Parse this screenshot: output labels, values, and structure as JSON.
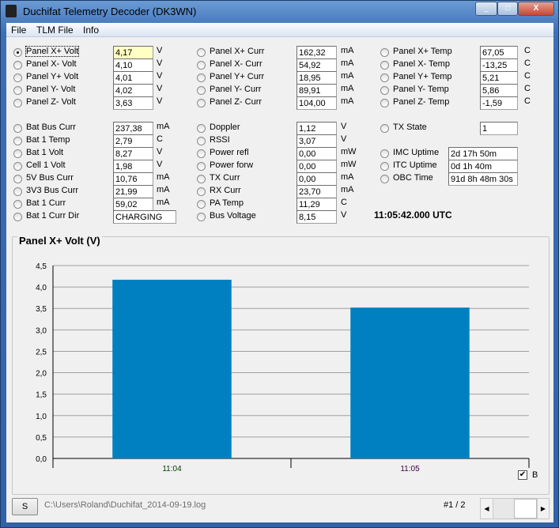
{
  "window": {
    "title": "Duchifat Telemetry Decoder (DK3WN)",
    "minimize": "_",
    "maximize": "□",
    "close": "X"
  },
  "menu": [
    "File",
    "TLM File",
    "Info"
  ],
  "col1": [
    {
      "label": "Panel X+ Volt",
      "value": "4,17",
      "unit": "V",
      "selected": true
    },
    {
      "label": "Panel X- Volt",
      "value": "4,10",
      "unit": "V"
    },
    {
      "label": "Panel Y+ Volt",
      "value": "4,01",
      "unit": "V"
    },
    {
      "label": "Panel Y- Volt",
      "value": "4,02",
      "unit": "V"
    },
    {
      "label": "Panel Z- Volt",
      "value": "3,63",
      "unit": "V"
    },
    {
      "label": "Bat Bus Curr",
      "value": "237,38",
      "unit": "mA"
    },
    {
      "label": "Bat 1 Temp",
      "value": "2,79",
      "unit": "C"
    },
    {
      "label": "Bat 1 Volt",
      "value": "8,27",
      "unit": "V"
    },
    {
      "label": "Cell 1 Volt",
      "value": "1,98",
      "unit": "V"
    },
    {
      "label": "5V Bus Curr",
      "value": "10,76",
      "unit": "mA"
    },
    {
      "label": "3V3 Bus Curr",
      "value": "21,99",
      "unit": "mA"
    },
    {
      "label": "Bat 1 Curr",
      "value": "59,02",
      "unit": "mA"
    },
    {
      "label": "Bat 1 Curr Dir",
      "value": "CHARGING",
      "unit": ""
    }
  ],
  "col2": [
    {
      "label": "Panel X+ Curr",
      "value": "162,32",
      "unit": "mA"
    },
    {
      "label": "Panel X- Curr",
      "value": "54,92",
      "unit": "mA"
    },
    {
      "label": "Panel Y+ Curr",
      "value": "18,95",
      "unit": "mA"
    },
    {
      "label": "Panel Y- Curr",
      "value": "89,91",
      "unit": "mA"
    },
    {
      "label": "Panel Z- Curr",
      "value": "104,00",
      "unit": "mA"
    },
    {
      "label": "Doppler",
      "value": "1,12",
      "unit": "V"
    },
    {
      "label": "RSSI",
      "value": "3,07",
      "unit": "V"
    },
    {
      "label": "Power refl",
      "value": "0,00",
      "unit": "mW"
    },
    {
      "label": "Power forw",
      "value": "0,00",
      "unit": "mW"
    },
    {
      "label": "TX Curr",
      "value": "0,00",
      "unit": "mA"
    },
    {
      "label": "RX Curr",
      "value": "23,70",
      "unit": "mA"
    },
    {
      "label": "PA Temp",
      "value": "11,29",
      "unit": "C"
    },
    {
      "label": "Bus Voltage",
      "value": "8,15",
      "unit": "V"
    }
  ],
  "col3": [
    {
      "label": "Panel X+ Temp",
      "value": "67,05",
      "unit": "C"
    },
    {
      "label": "Panel X- Temp",
      "value": "-13,25",
      "unit": "C"
    },
    {
      "label": "Panel Y+ Temp",
      "value": "5,21",
      "unit": "C"
    },
    {
      "label": "Panel Y- Temp",
      "value": "5,86",
      "unit": "C"
    },
    {
      "label": "Panel Z- Temp",
      "value": "-1,59",
      "unit": "C"
    },
    {
      "label": "TX State",
      "value": "1",
      "unit": ""
    }
  ],
  "uptimes": [
    {
      "label": "IMC Uptime",
      "value": "2d 17h 50m"
    },
    {
      "label": "ITC Uptime",
      "value": "0d 1h 40m"
    },
    {
      "label": "OBC Time",
      "value": "91d 8h 48m 30s"
    }
  ],
  "utc": "11:05:42.000 UTC",
  "chart_data": {
    "type": "bar",
    "title": "Panel X+ Volt (V)",
    "categories": [
      "11:04",
      "11:05"
    ],
    "values": [
      4.17,
      3.52
    ],
    "ylim": [
      0,
      4.5
    ],
    "yticks": [
      "0,0",
      "0,5",
      "1,0",
      "1,5",
      "2,0",
      "2,5",
      "3,0",
      "3,5",
      "4,0",
      "4,5"
    ],
    "grid": true,
    "bar_color": "#0080c0"
  },
  "checkbox": {
    "label": "B",
    "checked": true
  },
  "footer": {
    "button": "S",
    "path": "C:\\Users\\Roland\\Duchifat_2014-09-19.log",
    "page": "#1 / 2"
  }
}
